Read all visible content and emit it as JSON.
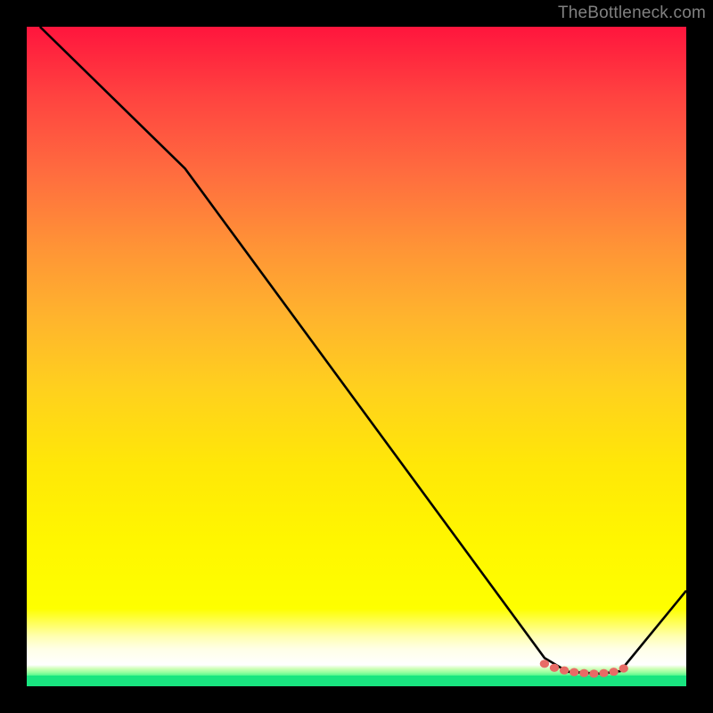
{
  "attribution": "TheBottleneck.com",
  "colors": {
    "background": "#000000",
    "line": "#000000",
    "marker": "#e86b66",
    "gradient_top": "#ff153d",
    "gradient_mid": "#ffd01e",
    "gradient_yellow": "#feff00",
    "gradient_green": "#19e580",
    "attribution_text": "#808080"
  },
  "chart_data": {
    "type": "line",
    "title": "",
    "xlabel": "",
    "ylabel": "",
    "xlim": [
      0,
      100
    ],
    "ylim": [
      0,
      100
    ],
    "note": "Axes are unlabeled; values below are percentages of plot width/height estimated from pixel positions. y=100 is top edge, y=0 is bottom green band.",
    "series": [
      {
        "name": "curve",
        "points": [
          {
            "x": 2.0,
            "y": 100.0
          },
          {
            "x": 24.0,
            "y": 78.5
          },
          {
            "x": 78.5,
            "y": 4.3
          },
          {
            "x": 82.0,
            "y": 2.2
          },
          {
            "x": 87.0,
            "y": 1.9
          },
          {
            "x": 90.0,
            "y": 2.3
          },
          {
            "x": 100.0,
            "y": 14.5
          }
        ]
      },
      {
        "name": "optimal-range-markers",
        "points": [
          {
            "x": 78.5,
            "y": 3.4
          },
          {
            "x": 80.0,
            "y": 2.8
          },
          {
            "x": 81.5,
            "y": 2.4
          },
          {
            "x": 83.0,
            "y": 2.15
          },
          {
            "x": 84.5,
            "y": 2.0
          },
          {
            "x": 86.0,
            "y": 1.9
          },
          {
            "x": 87.5,
            "y": 2.0
          },
          {
            "x": 89.0,
            "y": 2.2
          },
          {
            "x": 90.5,
            "y": 2.7
          }
        ]
      }
    ]
  }
}
